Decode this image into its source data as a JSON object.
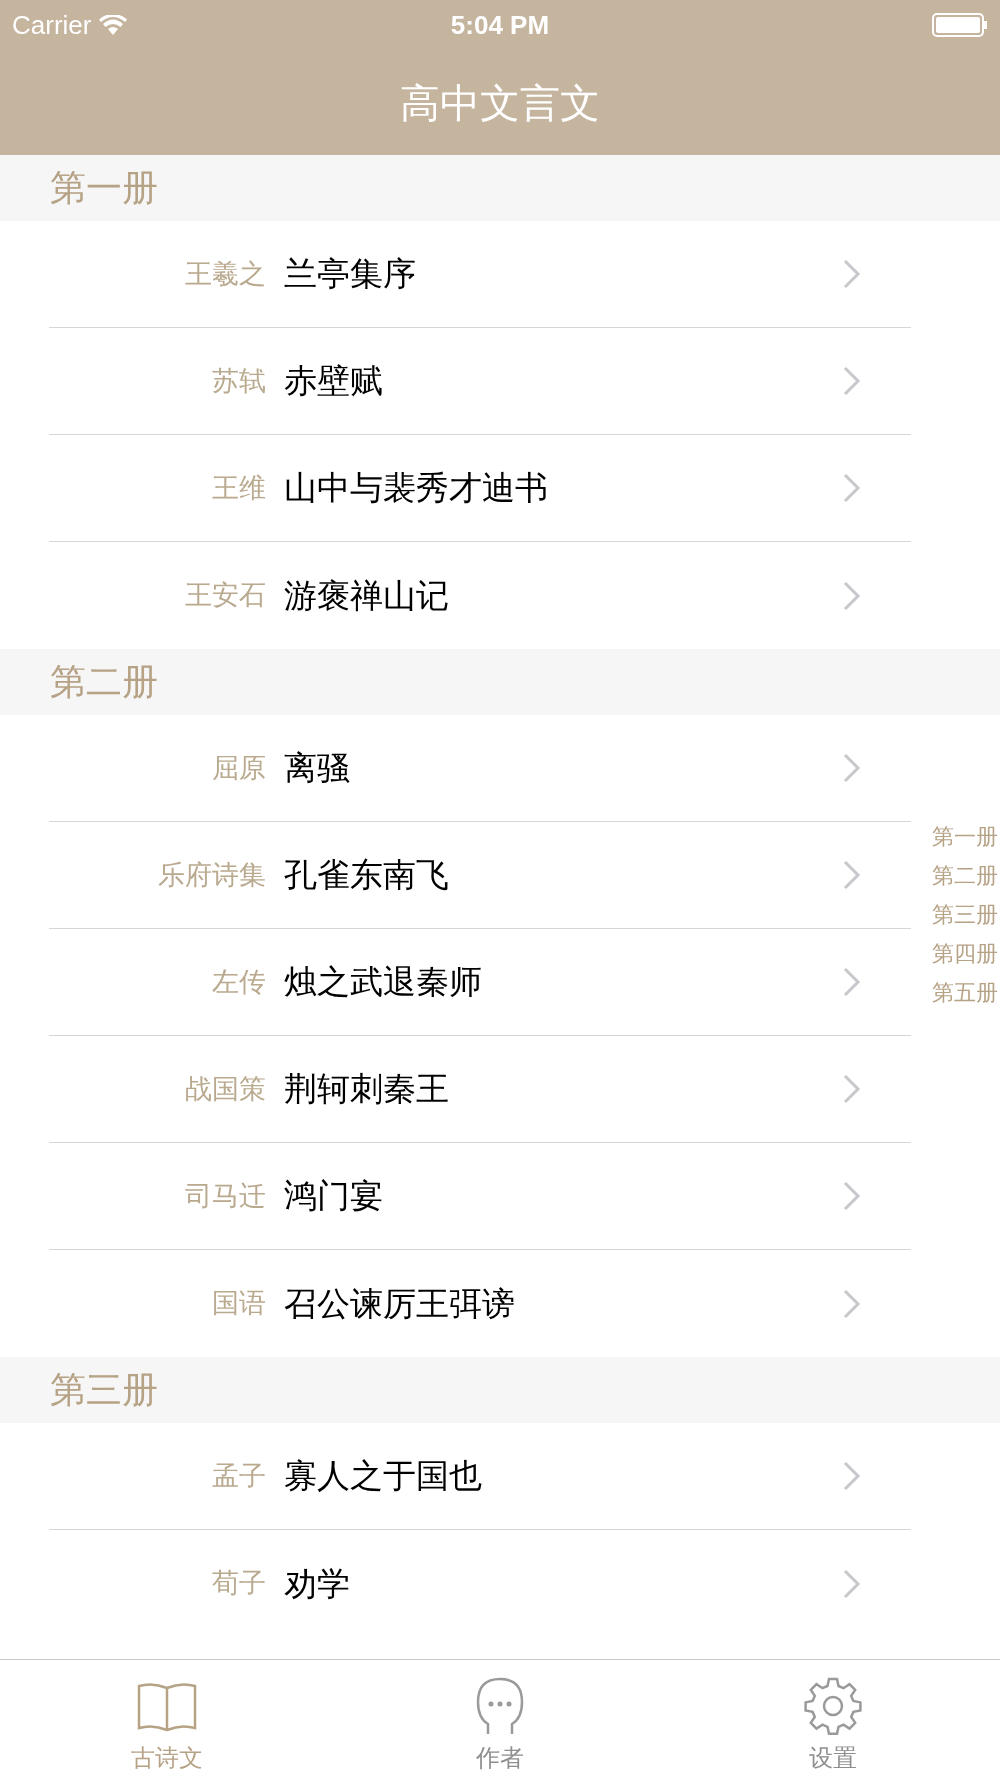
{
  "status_bar": {
    "carrier": "Carrier",
    "time": "5:04 PM"
  },
  "nav": {
    "title": "高中文言文"
  },
  "sections": [
    {
      "title": "第一册",
      "rows": [
        {
          "author": "王羲之",
          "title": "兰亭集序"
        },
        {
          "author": "苏轼",
          "title": "赤壁赋"
        },
        {
          "author": "王维",
          "title": "山中与裴秀才迪书"
        },
        {
          "author": "王安石",
          "title": "游褒禅山记"
        }
      ]
    },
    {
      "title": "第二册",
      "rows": [
        {
          "author": "屈原",
          "title": "离骚"
        },
        {
          "author": "乐府诗集",
          "title": "孔雀东南飞"
        },
        {
          "author": "左传",
          "title": "烛之武退秦师"
        },
        {
          "author": "战国策",
          "title": "荆轲刺秦王"
        },
        {
          "author": "司马迁",
          "title": "鸿门宴"
        },
        {
          "author": "国语",
          "title": "召公谏厉王弭谤"
        }
      ]
    },
    {
      "title": "第三册",
      "rows": [
        {
          "author": "孟子",
          "title": "寡人之于国也"
        },
        {
          "author": "荀子",
          "title": "劝学"
        }
      ]
    }
  ],
  "index": [
    "第一册",
    "第二册",
    "第三册",
    "第四册",
    "第五册"
  ],
  "tab_bar": [
    {
      "label": "古诗文",
      "kind": "book",
      "selected": true
    },
    {
      "label": "作者",
      "kind": "person",
      "selected": false
    },
    {
      "label": "设置",
      "kind": "gear",
      "selected": false
    }
  ]
}
